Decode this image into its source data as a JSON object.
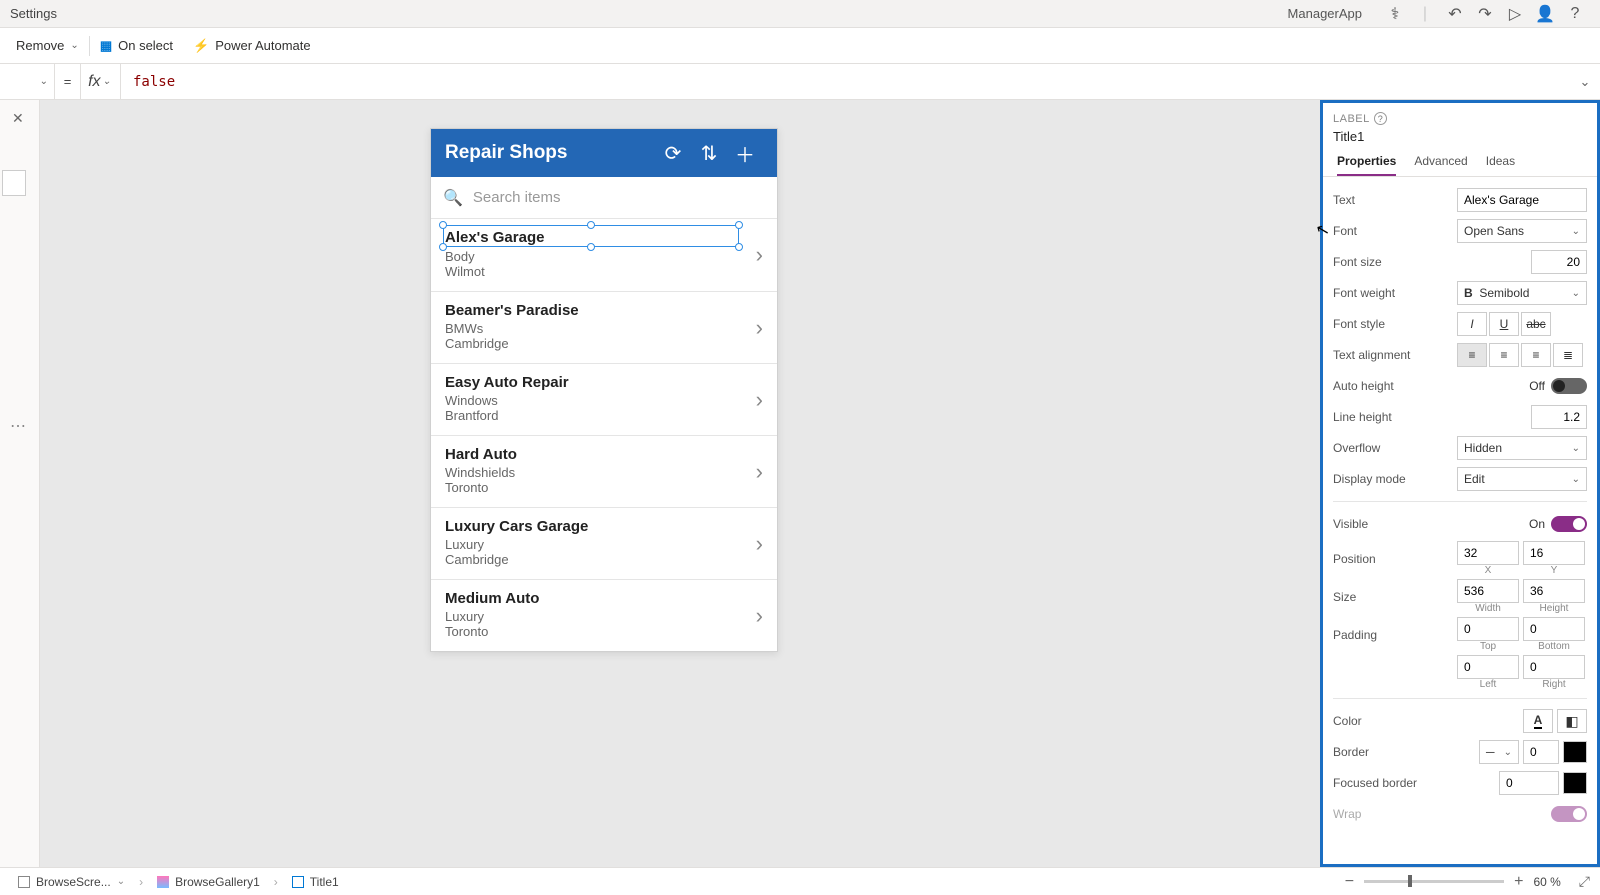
{
  "titlebar": {
    "label": "Settings",
    "appname": "ManagerApp"
  },
  "cmdbar": {
    "remove": "Remove",
    "onselect": "On select",
    "powerautomate": "Power Automate"
  },
  "formula": {
    "value": "false",
    "eq": "="
  },
  "phone": {
    "header": "Repair Shops",
    "search_placeholder": "Search items",
    "items": [
      {
        "title": "Alex's Garage",
        "sub1": "Body",
        "sub2": "Wilmot"
      },
      {
        "title": "Beamer's Paradise",
        "sub1": "BMWs",
        "sub2": "Cambridge"
      },
      {
        "title": "Easy Auto Repair",
        "sub1": "Windows",
        "sub2": "Brantford"
      },
      {
        "title": "Hard Auto",
        "sub1": "Windshields",
        "sub2": "Toronto"
      },
      {
        "title": "Luxury Cars Garage",
        "sub1": "Luxury",
        "sub2": "Cambridge"
      },
      {
        "title": "Medium Auto",
        "sub1": "Luxury",
        "sub2": "Toronto"
      }
    ]
  },
  "props": {
    "type": "LABEL",
    "name": "Title1",
    "tabs": {
      "properties": "Properties",
      "advanced": "Advanced",
      "ideas": "Ideas"
    },
    "text": {
      "label": "Text",
      "value": "Alex's Garage"
    },
    "font": {
      "label": "Font",
      "value": "Open Sans"
    },
    "fontsize": {
      "label": "Font size",
      "value": "20"
    },
    "fontweight": {
      "label": "Font weight",
      "value": "Semibold"
    },
    "fontstyle": {
      "label": "Font style"
    },
    "textalign": {
      "label": "Text alignment"
    },
    "autoheight": {
      "label": "Auto height",
      "state": "Off"
    },
    "lineheight": {
      "label": "Line height",
      "value": "1.2"
    },
    "overflow": {
      "label": "Overflow",
      "value": "Hidden"
    },
    "displaymode": {
      "label": "Display mode",
      "value": "Edit"
    },
    "visible": {
      "label": "Visible",
      "state": "On"
    },
    "position": {
      "label": "Position",
      "x": "32",
      "y": "16",
      "xl": "X",
      "yl": "Y"
    },
    "size": {
      "label": "Size",
      "w": "536",
      "h": "36",
      "wl": "Width",
      "hl": "Height"
    },
    "padding": {
      "label": "Padding",
      "top": "0",
      "bottom": "0",
      "left": "0",
      "right": "0",
      "tl": "Top",
      "bl": "Bottom",
      "ll": "Left",
      "rl": "Right"
    },
    "color": {
      "label": "Color"
    },
    "border": {
      "label": "Border",
      "value": "0"
    },
    "focusedborder": {
      "label": "Focused border",
      "value": "0"
    },
    "wrap": {
      "label": "Wrap"
    }
  },
  "bottombar": {
    "screen": "BrowseScre...",
    "gallery": "BrowseGallery1",
    "control": "Title1",
    "zoom": "60 %"
  }
}
